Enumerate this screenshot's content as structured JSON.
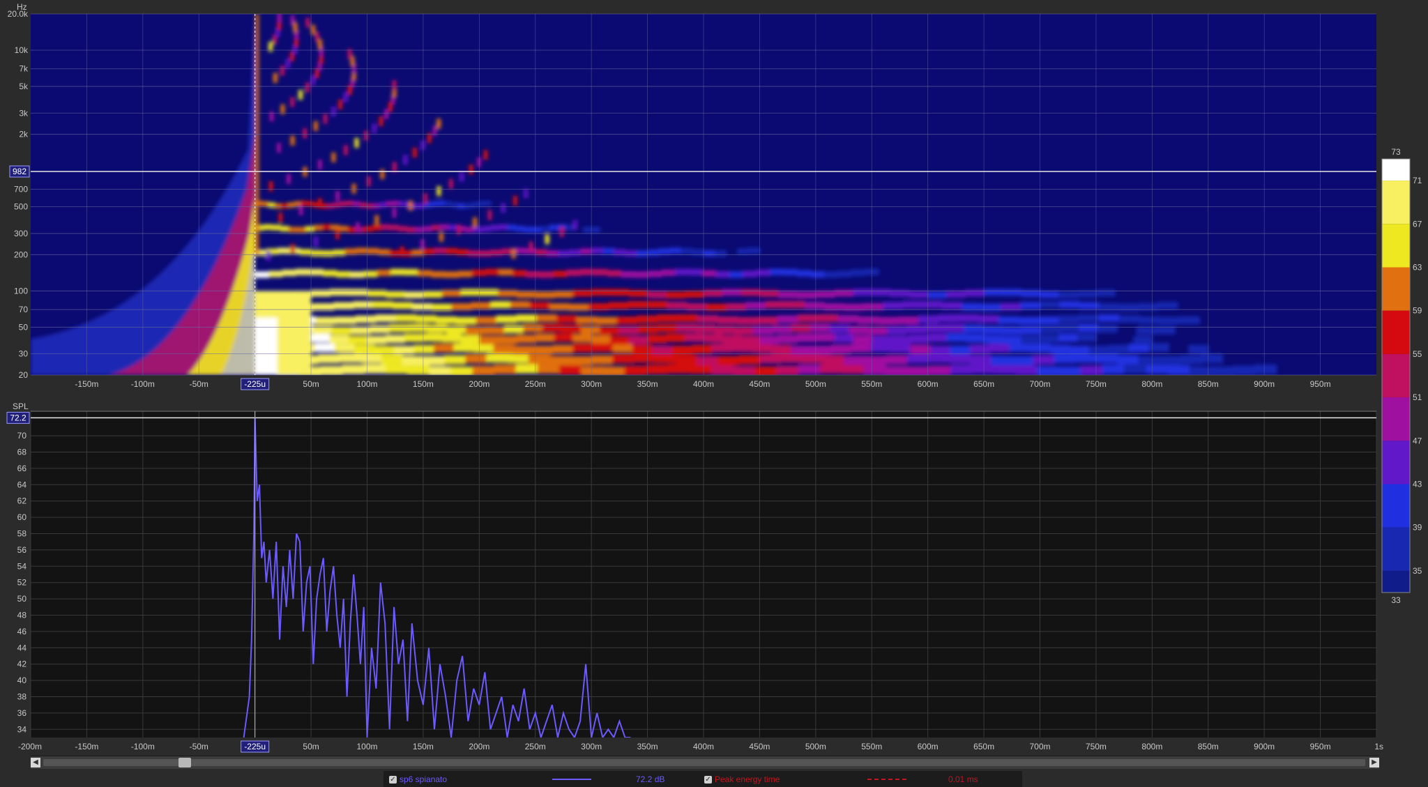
{
  "chart_data": [
    {
      "type": "heatmap",
      "panel": "spectrogram",
      "ylabel": "Hz",
      "x_tick_labels": [
        "-150m",
        "-100m",
        "-50m",
        "-225u",
        "50m",
        "100m",
        "150m",
        "200m",
        "250m",
        "300m",
        "350m",
        "400m",
        "450m",
        "500m",
        "550m",
        "600m",
        "650m",
        "700m",
        "750m",
        "800m",
        "850m",
        "900m",
        "950m"
      ],
      "y_tick_labels": [
        "20.0k",
        "10k",
        "7k",
        "5k",
        "3k",
        "2k",
        "982",
        "700",
        "500",
        "300",
        "200",
        "100",
        "70",
        "50",
        "30",
        "20"
      ],
      "xlim": [
        -0.2,
        1.0
      ],
      "ylim": [
        20,
        20000
      ],
      "y_scale": "log",
      "cursor": {
        "x_label": "-225u",
        "y_label": "982",
        "y_value": 982
      },
      "colorbar": {
        "min_label": "33",
        "max_label": "73",
        "tick_labels": [
          "71",
          "67",
          "63",
          "59",
          "55",
          "51",
          "47",
          "43",
          "39",
          "35"
        ],
        "bands": [
          {
            "from": 71,
            "to": 73,
            "color": "#ffffff"
          },
          {
            "from": 67,
            "to": 71,
            "color": "#f8f060"
          },
          {
            "from": 63,
            "to": 67,
            "color": "#eee820"
          },
          {
            "from": 59,
            "to": 63,
            "color": "#e07010"
          },
          {
            "from": 55,
            "to": 59,
            "color": "#d40a10"
          },
          {
            "from": 51,
            "to": 55,
            "color": "#c01060"
          },
          {
            "from": 47,
            "to": 51,
            "color": "#a010a0"
          },
          {
            "from": 43,
            "to": 47,
            "color": "#6018c8"
          },
          {
            "from": 39,
            "to": 43,
            "color": "#2030e0"
          },
          {
            "from": 35,
            "to": 39,
            "color": "#1828b0"
          },
          {
            "from": 33,
            "to": 35,
            "color": "#101c8a"
          }
        ]
      },
      "decay": {
        "peak_time": 0,
        "ridges_hz": [
          22,
          27,
          33,
          40,
          48,
          58,
          75,
          95,
          140,
          210,
          330,
          520
        ],
        "ridge_end_time": [
          0.93,
          0.9,
          0.85,
          0.8,
          0.82,
          0.86,
          0.84,
          0.8,
          0.58,
          0.48,
          0.36,
          0.28
        ]
      }
    },
    {
      "type": "line",
      "panel": "spl",
      "ylabel": "SPL",
      "x_tick_labels": [
        "-200m",
        "-150m",
        "-100m",
        "-50m",
        "-225u",
        "50m",
        "100m",
        "150m",
        "200m",
        "250m",
        "300m",
        "350m",
        "400m",
        "450m",
        "500m",
        "550m",
        "600m",
        "650m",
        "700m",
        "750m",
        "800m",
        "850m",
        "900m",
        "950m",
        "1s"
      ],
      "y_ticks": [
        34,
        36,
        38,
        40,
        42,
        44,
        46,
        48,
        50,
        52,
        54,
        56,
        58,
        60,
        62,
        64,
        66,
        68,
        70
      ],
      "xlim": [
        -0.2,
        1.0
      ],
      "ylim": [
        33,
        73
      ],
      "cursor": {
        "x_label": "-225u",
        "y_label": "72.2",
        "y_value": 72.2
      },
      "series": [
        {
          "name": "sp6 spianato",
          "color": "#6a5aff",
          "x": [
            -0.01,
            -0.005,
            -0.003,
            -0.001,
            0.0,
            0.002,
            0.004,
            0.006,
            0.008,
            0.01,
            0.013,
            0.016,
            0.019,
            0.022,
            0.025,
            0.028,
            0.031,
            0.034,
            0.037,
            0.04,
            0.043,
            0.046,
            0.049,
            0.052,
            0.055,
            0.058,
            0.061,
            0.064,
            0.067,
            0.07,
            0.073,
            0.076,
            0.079,
            0.082,
            0.085,
            0.088,
            0.091,
            0.094,
            0.097,
            0.1,
            0.104,
            0.108,
            0.112,
            0.116,
            0.12,
            0.124,
            0.128,
            0.132,
            0.136,
            0.14,
            0.145,
            0.15,
            0.155,
            0.16,
            0.165,
            0.17,
            0.175,
            0.18,
            0.185,
            0.19,
            0.195,
            0.2,
            0.205,
            0.21,
            0.215,
            0.22,
            0.225,
            0.23,
            0.235,
            0.24,
            0.245,
            0.25,
            0.255,
            0.26,
            0.265,
            0.27,
            0.275,
            0.28,
            0.285,
            0.29,
            0.295,
            0.3,
            0.305,
            0.31,
            0.315,
            0.32,
            0.325,
            0.33,
            0.335
          ],
          "y": [
            33,
            38,
            45,
            58,
            72.2,
            62,
            64,
            55,
            57,
            52,
            56,
            50,
            57,
            45,
            54,
            49,
            56,
            50,
            58,
            57,
            46,
            52,
            54,
            42,
            50,
            53,
            55,
            46,
            51,
            54,
            48,
            44,
            50,
            38,
            47,
            53,
            48,
            42,
            49,
            33,
            44,
            39,
            52,
            47,
            34,
            49,
            42,
            45,
            35,
            47,
            40,
            37,
            44,
            34,
            42,
            38,
            33,
            40,
            43,
            35,
            39,
            37,
            41,
            34,
            36,
            38,
            33,
            37,
            35,
            39,
            34,
            36,
            33,
            35,
            37,
            33,
            36,
            34,
            33,
            35,
            42,
            33,
            36,
            33,
            34,
            33,
            35,
            33,
            33
          ]
        }
      ]
    }
  ],
  "legend": {
    "series_label": "sp6 spianato",
    "series_value": "72.2 dB",
    "series_color": "#6a5aff",
    "peak_label": "Peak energy time",
    "peak_value": "0.01 ms",
    "peak_color": "#c8141e"
  },
  "scrollbar": {
    "left_arrow": "◀",
    "right_arrow": "▶"
  }
}
